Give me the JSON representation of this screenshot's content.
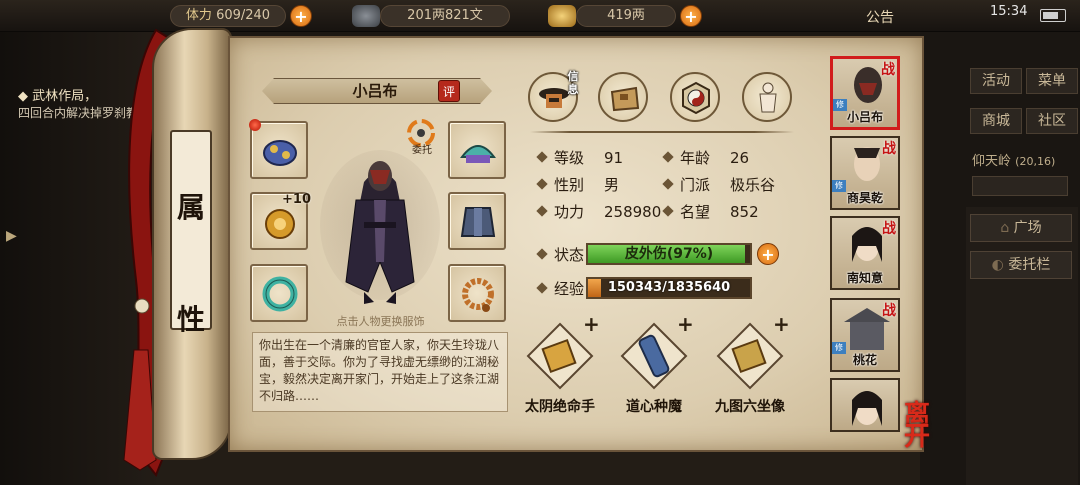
{
  "topbar": {
    "stamina_label": "体力",
    "stamina": "609/240",
    "silver": "201两821文",
    "gold": "419两",
    "notice": "公告",
    "time": "15:34"
  },
  "quest": {
    "title": "武林作局，",
    "desc": "四回合内解决掉罗刹教小队"
  },
  "scroll": {
    "label_top": "属",
    "label_bottom": "性"
  },
  "character": {
    "name": "小吕布",
    "rate_badge": "评",
    "entrust_label": "委托",
    "equip_plus": "+10",
    "change_hint": "点击人物更换服饰",
    "bio": "你出生在一个清廉的官宦人家，你天生玲珑八面，善于交际。你为了寻找虚无缥缈的江湖秘宝，毅然决定离开家门，开始走上了这条江湖不归路……"
  },
  "tabs": {
    "info_label": "信息"
  },
  "stats": {
    "level_label": "等级",
    "level": "91",
    "age_label": "年龄",
    "age": "26",
    "gender_label": "性别",
    "gender": "男",
    "sect_label": "门派",
    "sect": "极乐谷",
    "power_label": "功力",
    "power": "258980",
    "fame_label": "名望",
    "fame": "852",
    "status_label": "状态",
    "status_text": "皮外伤(97%)",
    "status_percent": 97,
    "exp_label": "经验",
    "exp_text": "150343/1835640",
    "exp_fraction": 0.0819
  },
  "skills": [
    {
      "name": "太阴绝命手",
      "plus": "+"
    },
    {
      "name": "道心种魔",
      "plus": "+"
    },
    {
      "name": "九图六坐像",
      "plus": "+"
    }
  ],
  "roster": [
    {
      "name": "小吕布",
      "tag": "战",
      "sub": "修"
    },
    {
      "name": "商昊乾",
      "tag": "战",
      "sub": "修"
    },
    {
      "name": "南知意",
      "tag": "战",
      "sub": ""
    },
    {
      "name": "桃花",
      "tag": "战",
      "sub": "修"
    },
    {
      "name": "",
      "tag": "",
      "sub": ""
    }
  ],
  "leave": "离开",
  "right_menu": {
    "activity": "活动",
    "menu": "菜单",
    "shop": "商城",
    "community": "社区",
    "location": "仰天岭",
    "coords": "(20,16)",
    "square": "广场",
    "entrust_bar": "委托栏"
  },
  "colors": {
    "accent_red": "#c51414",
    "status_green": "#3e9a24",
    "exp_orange": "#bf6516"
  }
}
